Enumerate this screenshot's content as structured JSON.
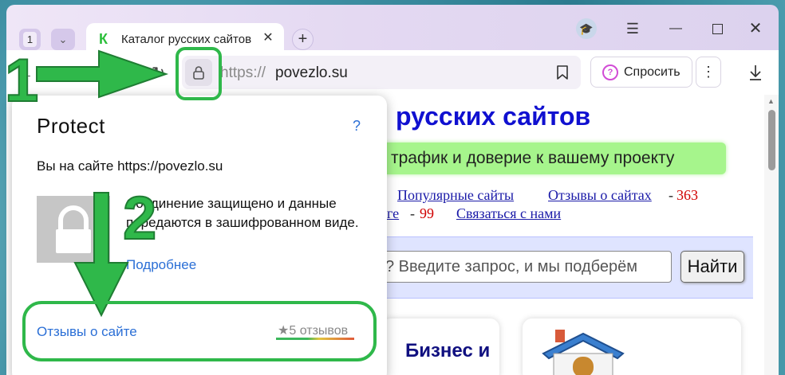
{
  "tabs": {
    "counter": "1",
    "active_title": "Каталог русских сайтов",
    "favicon_letter": "К"
  },
  "omnibox": {
    "url_prefix": "https://",
    "url_host": "povezlo.su"
  },
  "toolbar": {
    "ask_label": "Спросить"
  },
  "page": {
    "title": "русских сайтов",
    "slogan": "трафик и доверие к вашему проекту",
    "nav": [
      {
        "label": "Популярные сайты"
      },
      {
        "label": "Отзывы о сайтах",
        "count": "363"
      },
      {
        "label": "ге",
        "count": "99"
      },
      {
        "label": "Связаться с нами"
      }
    ],
    "search_placeholder": "? Введите запрос, и мы подберём",
    "search_button": "Найти",
    "card_title": "Бизнес и"
  },
  "popup": {
    "title": "Protect",
    "help": "?",
    "site_line": "Вы на сайте https://povezlo.su",
    "security_text": "Соединение защищено и данные передаются в зашифрованном виде.",
    "more_link": "Подробнее",
    "reviews_link": "Отзывы о сайте",
    "reviews_count": "5 отзывов"
  },
  "annotations": {
    "step1": "1",
    "step2": "2",
    "color": "#2fb84a"
  },
  "colors": {
    "brand_green": "#2bbf3a",
    "link_blue": "#2b6fd6",
    "site_title_blue": "#1010d0",
    "slogan_green": "#a6f58c"
  }
}
